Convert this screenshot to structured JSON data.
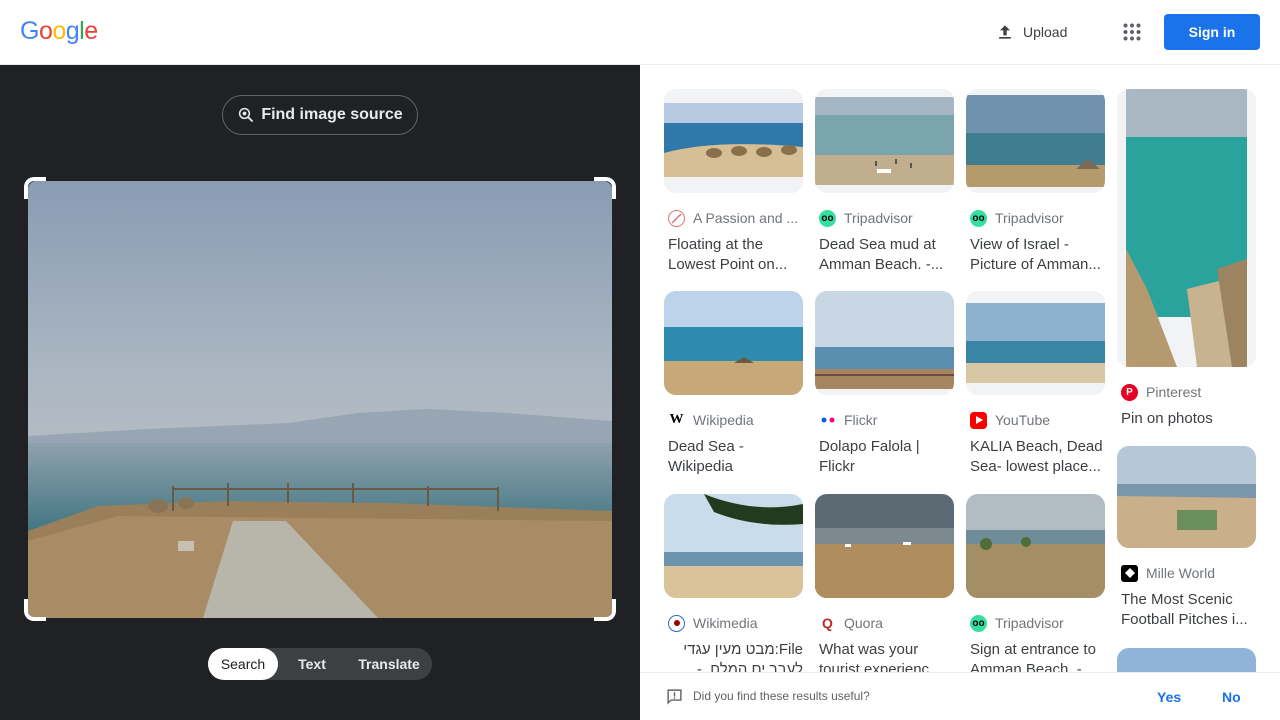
{
  "header": {
    "logo_letters": [
      "G",
      "o",
      "o",
      "g",
      "l",
      "e"
    ],
    "logo_colors": [
      "#4285f4",
      "#ea4335",
      "#fbbc05",
      "#4285f4",
      "#34a853",
      "#ea4335"
    ],
    "upload_label": "Upload",
    "signin_label": "Sign in"
  },
  "left": {
    "find_source_label": "Find image source",
    "modes": [
      "Search",
      "Text",
      "Translate"
    ]
  },
  "results": [
    {
      "source": "A Passion and ...",
      "title": "Floating at the Lowest Point on..."
    },
    {
      "source": "Tripadvisor",
      "title": "Dead Sea mud at Amman Beach. -..."
    },
    {
      "source": "Tripadvisor",
      "title": "View of Israel - Picture of Amman..."
    },
    {
      "source": "Pinterest",
      "title": "Pin on photos"
    },
    {
      "source": "Wikipedia",
      "title": "Dead Sea - Wikipedia"
    },
    {
      "source": "Flickr",
      "title": "Dolapo Falola | Flickr"
    },
    {
      "source": "YouTube",
      "title": "KALIA Beach, Dead Sea- lowest place..."
    },
    {
      "source": "Mille World",
      "title": "The Most Scenic Football Pitches i..."
    },
    {
      "source": "Wikimedia",
      "title": "File:מבט מעין עגדי לעבר ים המלח. -jpg..."
    },
    {
      "source": "Quora",
      "title": "What was your tourist experienc..."
    },
    {
      "source": "Tripadvisor",
      "title": "Sign at entrance to Amman Beach. -..."
    }
  ],
  "feedback": {
    "question": "Did you find these results useful?",
    "yes": "Yes",
    "no": "No"
  },
  "colors": {
    "accent": "#1a73e8",
    "dark_panel": "#202124",
    "tripadvisor": "#34e0a1",
    "pinterest": "#e60023",
    "youtube": "#ff0000",
    "quora": "#b92b27"
  }
}
